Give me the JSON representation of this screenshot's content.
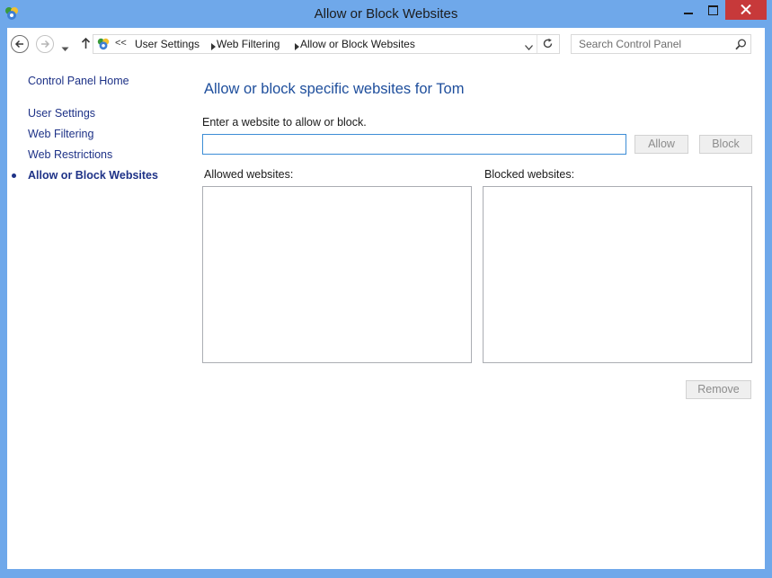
{
  "window": {
    "title": "Allow or Block Websites",
    "accent_color": "#6fa8ea",
    "close_color": "#c7393a"
  },
  "titlebar": {
    "icon": "parental-controls-icon",
    "minimize_icon": "minimize-icon",
    "maximize_icon": "maximize-icon",
    "close_icon": "close-icon"
  },
  "nav": {
    "back_icon": "back-arrow-icon",
    "forward_icon": "forward-arrow-icon",
    "recent_icon": "chevron-down-icon",
    "up_icon": "up-arrow-icon"
  },
  "address": {
    "overflow": "<<",
    "breadcrumbs": [
      "User Settings",
      "Web Filtering",
      "Allow or Block Websites"
    ],
    "refresh_icon": "refresh-icon"
  },
  "search": {
    "placeholder": "Search Control Panel",
    "value": ""
  },
  "sidebar": {
    "home": "Control Panel Home",
    "items": [
      {
        "label": "User Settings",
        "current": false
      },
      {
        "label": "Web Filtering",
        "current": false
      },
      {
        "label": "Web Restrictions",
        "current": false
      },
      {
        "label": "Allow or Block Websites",
        "current": true
      }
    ]
  },
  "main": {
    "heading": "Allow or block specific websites for Tom",
    "prompt": "Enter a website to allow or block.",
    "website_value": "",
    "allow_button": "Allow",
    "block_button": "Block",
    "allowed_label": "Allowed websites:",
    "blocked_label": "Blocked websites:",
    "allowed_items": [],
    "blocked_items": [],
    "remove_button": "Remove"
  }
}
